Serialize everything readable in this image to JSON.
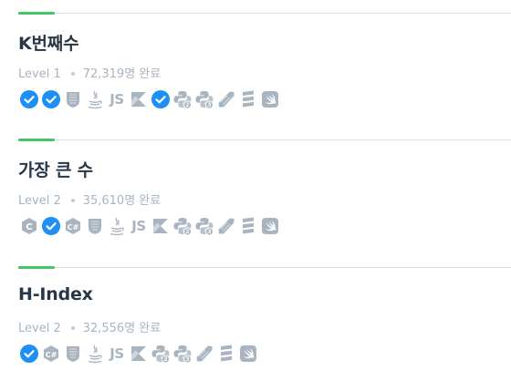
{
  "problems": [
    {
      "title": "K번째수",
      "level": "Level 1",
      "solved": "72,319명 완료",
      "languages": [
        {
          "name": "c",
          "completed": true
        },
        {
          "name": "cpp",
          "completed": true
        },
        {
          "name": "javascript-badge",
          "completed": false
        },
        {
          "name": "java",
          "completed": false
        },
        {
          "name": "javascript",
          "completed": false
        },
        {
          "name": "kotlin",
          "completed": false
        },
        {
          "name": "python",
          "completed": true
        },
        {
          "name": "python2",
          "completed": false
        },
        {
          "name": "python3",
          "completed": false
        },
        {
          "name": "ruby",
          "completed": false
        },
        {
          "name": "scala",
          "completed": false
        },
        {
          "name": "swift",
          "completed": false
        }
      ]
    },
    {
      "title": "가장 큰 수",
      "level": "Level 2",
      "solved": "35,610명 완료",
      "languages": [
        {
          "name": "c",
          "completed": false
        },
        {
          "name": "cpp",
          "completed": true
        },
        {
          "name": "csharp",
          "completed": false
        },
        {
          "name": "javascript-badge",
          "completed": false
        },
        {
          "name": "java",
          "completed": false
        },
        {
          "name": "javascript",
          "completed": false
        },
        {
          "name": "kotlin",
          "completed": false
        },
        {
          "name": "python2",
          "completed": false
        },
        {
          "name": "python3",
          "completed": false
        },
        {
          "name": "ruby",
          "completed": false
        },
        {
          "name": "scala",
          "completed": false
        },
        {
          "name": "swift",
          "completed": false
        }
      ]
    },
    {
      "title": "H-Index",
      "level": "Level 2",
      "solved": "32,556명 완료",
      "languages": [
        {
          "name": "cpp",
          "completed": true
        },
        {
          "name": "csharp",
          "completed": false
        },
        {
          "name": "javascript-badge",
          "completed": false
        },
        {
          "name": "java",
          "completed": false
        },
        {
          "name": "javascript",
          "completed": false
        },
        {
          "name": "kotlin",
          "completed": false
        },
        {
          "name": "python2",
          "completed": false
        },
        {
          "name": "python3",
          "completed": false
        },
        {
          "name": "ruby",
          "completed": false
        },
        {
          "name": "scala",
          "completed": false
        },
        {
          "name": "swift",
          "completed": false
        }
      ]
    }
  ],
  "colors": {
    "accent": "#44c767",
    "check": "#1e8ff4",
    "icon_gray": "#a8b4c0",
    "title": "#263747",
    "meta": "#a8b4c0"
  }
}
